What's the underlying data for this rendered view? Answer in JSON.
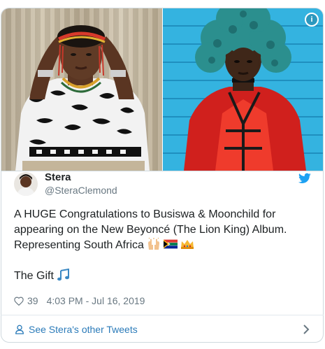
{
  "media": {
    "info_icon": "info-icon",
    "info_label": "i"
  },
  "author": {
    "display_name": "Stera",
    "handle": "@SteraClemond",
    "avatar_icon": "avatar"
  },
  "tweet": {
    "text_line_1": "A HUGE Congratulations to Busiswa & Moonchild for appearing on the New Beyoncé (The Lion King) Album. Representing South Africa",
    "emojis": [
      "raising-hands-emoji",
      "south-africa-flag-emoji",
      "crown-emoji"
    ],
    "text_line_2": "The Gift",
    "trailing_emoji": "musical-notes-emoji"
  },
  "meta": {
    "likes": "39",
    "timestamp": "4:03 PM - Jul 16, 2019"
  },
  "footer": {
    "link_label": "See Stera's other Tweets"
  },
  "colors": {
    "link": "#2b7bb9",
    "twitter_blue": "#1da1f2",
    "muted": "#697882",
    "text": "#1c2022"
  }
}
